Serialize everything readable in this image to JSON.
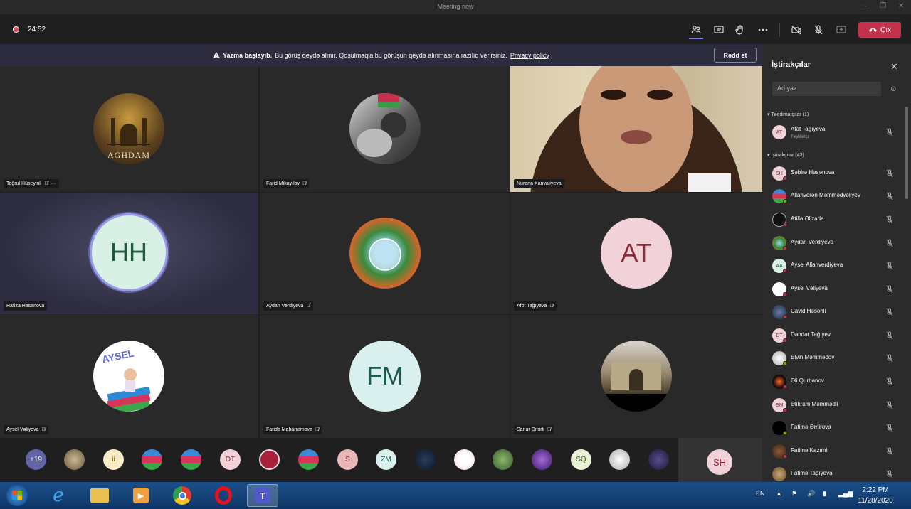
{
  "window": {
    "title": "Meeting now",
    "min": "—",
    "restore": "❐",
    "close": "✕"
  },
  "toolbar": {
    "timer": "24:52",
    "leave_label": "Çıx"
  },
  "banner": {
    "bold": "Yazma başlayıb.",
    "text": "Bu görüş qeydə alınır. Qoşulmaqla bu görüşün qeydə alınmasına razılıq verirsiniz.",
    "link": "Privacy policy",
    "dismiss": "Rədd et"
  },
  "tiles": [
    {
      "name": "Toğrul Hüseyinli",
      "logo_text": "AGHDAM",
      "more": "···"
    },
    {
      "name": "Farid Mikayılov"
    },
    {
      "name": "Nurana Xanvaliyeva"
    },
    {
      "name": "Hafiza Hasanova",
      "initials": "HH"
    },
    {
      "name": "Aydan Verdiyeva"
    },
    {
      "name": "Afət Tağıyeva",
      "initials": "AT"
    },
    {
      "name": "Aysel Vəliyeva",
      "logo_text": "AYSEL"
    },
    {
      "name": "Farida Maharramova",
      "initials": "FM"
    },
    {
      "name": "Sanur Əmirli"
    }
  ],
  "strip": {
    "more": "+19",
    "items": [
      "",
      "ii",
      "",
      "",
      "DT",
      "",
      "",
      "S",
      "ZM",
      "",
      "",
      "",
      "",
      "SQ",
      "",
      ""
    ],
    "active": "SH"
  },
  "panel": {
    "title": "İştirakçılar",
    "search_placeholder": "Ad yaz",
    "presenters_label": "Təqdimatçılar (1)",
    "presenters": [
      {
        "initials": "AT",
        "name": "Afət Tağıyeva",
        "role": "Təşkilatçı"
      }
    ],
    "attendees_label": "İştirakçılar (43)",
    "attendees": [
      {
        "initials": "SH",
        "name": "Səbirə Həsənova"
      },
      {
        "initials": "",
        "name": "Allahverən Məmmədvəliyev"
      },
      {
        "initials": "",
        "name": "Atilla Əlizadə"
      },
      {
        "initials": "",
        "name": "Aydan Verdiyeva"
      },
      {
        "initials": "AA",
        "name": "Aysel Allahverdiyeva"
      },
      {
        "initials": "",
        "name": "Aysel Vəliyeva"
      },
      {
        "initials": "",
        "name": "Cavid Həsənli"
      },
      {
        "initials": "DT",
        "name": "Dəndər Tağıyev"
      },
      {
        "initials": "",
        "name": "Elvin Məmmədov"
      },
      {
        "initials": "",
        "name": "Əli Qurbanov"
      },
      {
        "initials": "ƏM",
        "name": "Əlikram Məmmədli"
      },
      {
        "initials": "",
        "name": "Fatimə Əmirova"
      },
      {
        "initials": "",
        "name": "Fatimə Kazımlı"
      },
      {
        "initials": "",
        "name": "Fatimə Tağıyeva"
      }
    ]
  },
  "taskbar": {
    "lang": "EN",
    "time": "2:22 PM",
    "date": "11/28/2020"
  },
  "colors": {
    "accent": "#6264a7",
    "leave": "#c4314b",
    "avatar_pink": "#f1d2d8",
    "avatar_mint": "#d9f0e6"
  }
}
